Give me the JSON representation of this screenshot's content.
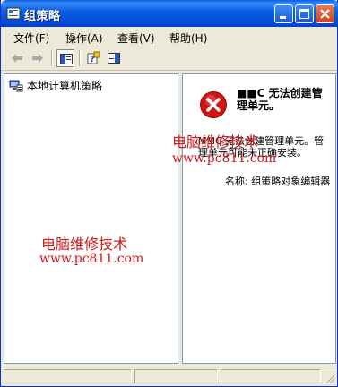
{
  "window": {
    "title": "组策略",
    "icon": "group-policy-app-icon",
    "controls": [
      "minimize",
      "maximize",
      "close"
    ]
  },
  "menu": [
    {
      "label": "文件(F)"
    },
    {
      "label": "操作(A)"
    },
    {
      "label": "查看(V)"
    },
    {
      "label": "帮助(H)"
    }
  ],
  "toolbar": {
    "buttons": [
      "back-arrow",
      "forward-arrow",
      "show-hide-console-tree",
      "help",
      "show-hide-action-pane"
    ]
  },
  "tree": {
    "root_label": "本地计算机策略"
  },
  "error": {
    "title": "■■C 无法创建管理单元。",
    "body": "MMC 无法创建管理单元。管理单元可能未正确安装。",
    "name_line": "名称: 组策略对象编辑器"
  },
  "watermarks": {
    "cn": "电脑维修技术",
    "url": "www.pc811.com"
  },
  "colors": {
    "titlebar": "#0a5fe5",
    "error_red": "#d21414",
    "watermark": "#d01818"
  }
}
